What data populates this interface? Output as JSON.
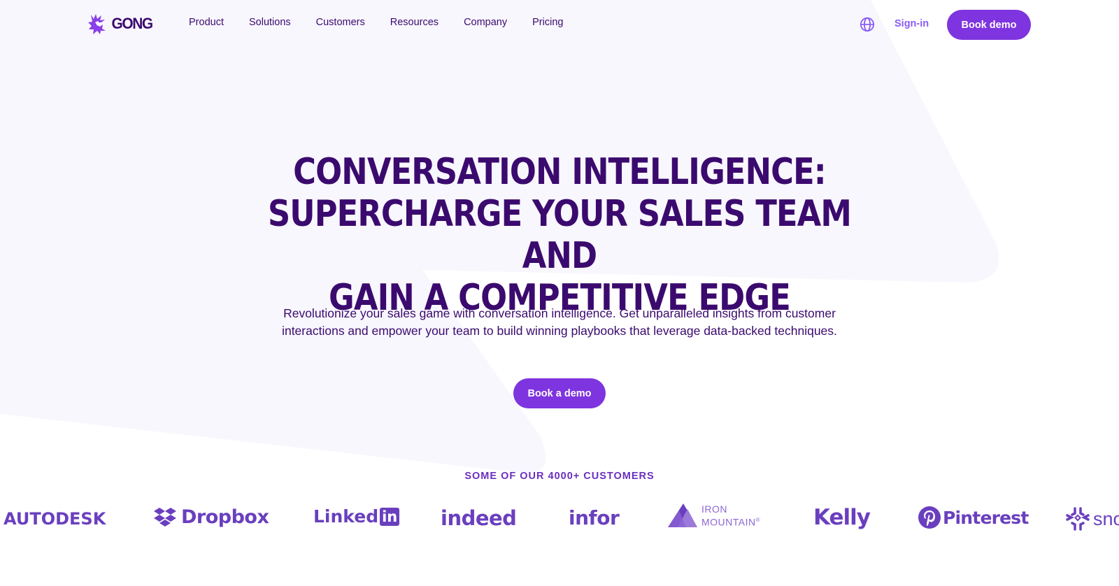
{
  "nav": {
    "logo_text": "GONG",
    "links": [
      {
        "label": "Product"
      },
      {
        "label": "Solutions"
      },
      {
        "label": "Customers"
      },
      {
        "label": "Resources"
      },
      {
        "label": "Company"
      },
      {
        "label": "Pricing"
      }
    ],
    "language_icon": "globe-icon",
    "signin_label": "Sign-in",
    "book_demo_label": "Book demo"
  },
  "hero": {
    "title_lines": [
      "CONVERSATION INTELLIGENCE:",
      "SUPERCHARGE YOUR SALES TEAM AND",
      "GAIN A COMPETITIVE EDGE"
    ],
    "subtitle_lines": [
      "Revolutionize your sales game with conversation intelligence. Get unparalleled insights from customer",
      "interactions and empower your team to build winning playbooks that leverage data-backed techniques."
    ],
    "cta_label": "Book a demo"
  },
  "customers": {
    "label": "SOME OF OUR 4000+ CUSTOMERS",
    "logos": [
      {
        "name": "AUTODESK"
      },
      {
        "name": "Dropbox"
      },
      {
        "name": "Linked",
        "suffix": "in"
      },
      {
        "name": "indeed"
      },
      {
        "name": "infor"
      },
      {
        "name_line1": "IRON",
        "name_line2": "MOUNTAIN",
        "mark": "®"
      },
      {
        "name": "Kelly"
      },
      {
        "name": "Pinterest"
      },
      {
        "name": "sno"
      }
    ]
  },
  "colors": {
    "brand_dark": "#3b0a6e",
    "brand_purple": "#7e34df",
    "link_purple": "#8b5cf6",
    "logo_purple": "#6a3fbe",
    "bg_shape": "#f8f7fe"
  }
}
